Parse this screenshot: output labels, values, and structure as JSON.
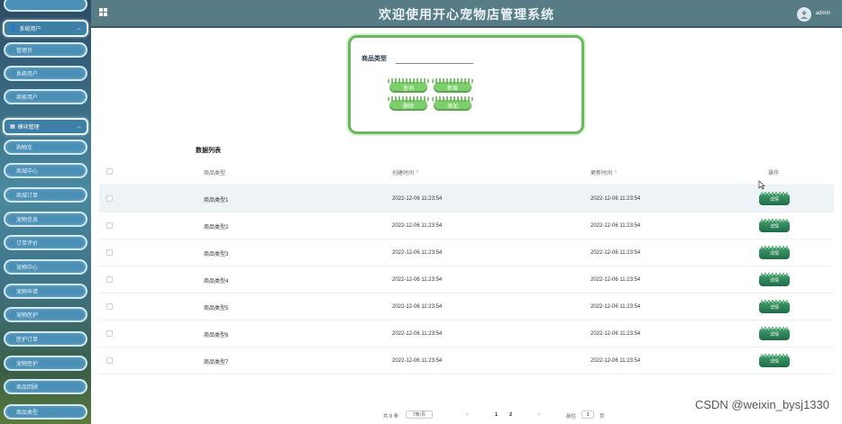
{
  "header": {
    "title": "欢迎使用开心宠物店管理系统",
    "user": "admin"
  },
  "sidebar": {
    "group1": "系统用户",
    "group1_items": [
      "管理员",
      "系统用户",
      "商家用户"
    ],
    "group2": "模块管理",
    "group2_items": [
      "购物车",
      "商城中心",
      "商城订单",
      "宠物信息",
      "订单评价",
      "宠物中心",
      "宠物申请",
      "宠物医护",
      "医护订单",
      "宠物医护",
      "商品回顾",
      "商品类型"
    ]
  },
  "search": {
    "label": "商品类型",
    "placeholder": "",
    "buttons": [
      "查询",
      "新增",
      "删除",
      "添加"
    ]
  },
  "list": {
    "title": "数据列表",
    "headers": {
      "type": "商品类型",
      "created": "创建时间",
      "updated": "更新时间",
      "op": "操作"
    },
    "sort_mark": "⇕",
    "detail_label": "详情",
    "rows": [
      {
        "type": "商品类型1",
        "created": "2022-12-06 11:23:54",
        "updated": "2022-12-06 11:23:54"
      },
      {
        "type": "商品类型2",
        "created": "2022-12-06 11:23:54",
        "updated": "2022-12-06 11:23:54"
      },
      {
        "type": "商品类型3",
        "created": "2022-12-06 11:23:54",
        "updated": "2022-12-06 11:23:54"
      },
      {
        "type": "商品类型4",
        "created": "2022-12-06 11:23:54",
        "updated": "2022-12-06 11:23:54"
      },
      {
        "type": "商品类型5",
        "created": "2022-12-06 11:23:54",
        "updated": "2022-12-06 11:23:54"
      },
      {
        "type": "商品类型6",
        "created": "2022-12-06 11:23:54",
        "updated": "2022-12-06 11:23:54"
      },
      {
        "type": "商品类型7",
        "created": "2022-12-06 11:23:54",
        "updated": "2022-12-06 11:23:54"
      }
    ]
  },
  "pager": {
    "total": "共 8 条",
    "size": "7条/页",
    "prev": "<",
    "p1": "1",
    "p2": "2",
    "next": ">",
    "goto": "前往",
    "goto_value": "1",
    "unit": "页"
  },
  "watermark": "CSDN @weixin_bysj1330"
}
